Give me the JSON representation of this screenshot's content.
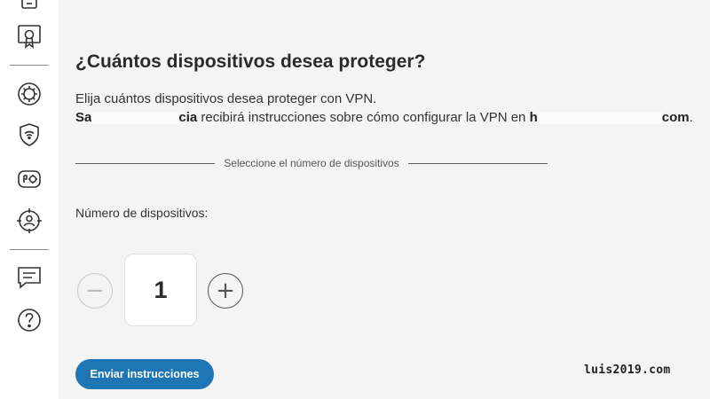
{
  "sidebar": {
    "icons": [
      "device-icon",
      "certificate-icon",
      "virus-icon",
      "wifi-shield-icon",
      "chip-icon",
      "target-icon",
      "chat-icon",
      "help-icon"
    ]
  },
  "main": {
    "title": "¿Cuántos dispositivos desea proteger?",
    "desc_line1": "Elija cuántos dispositivos desea proteger con VPN.",
    "desc_line2_start": "Sa",
    "desc_line2_bold": "cia",
    "desc_line2_mid": " recibirá instrucciones sobre cómo configurar la VPN en ",
    "desc_line2_bold2": "h",
    "desc_line2_end": "com",
    "desc_line2_period": ".",
    "section_label": "Seleccione el número de dispositivos",
    "devices_label": "Número de dispositivos:",
    "minus_symbol": "−",
    "plus_symbol": "+",
    "device_count": "1",
    "send_button": "Enviar instrucciones"
  },
  "watermark": "luis2019.com"
}
